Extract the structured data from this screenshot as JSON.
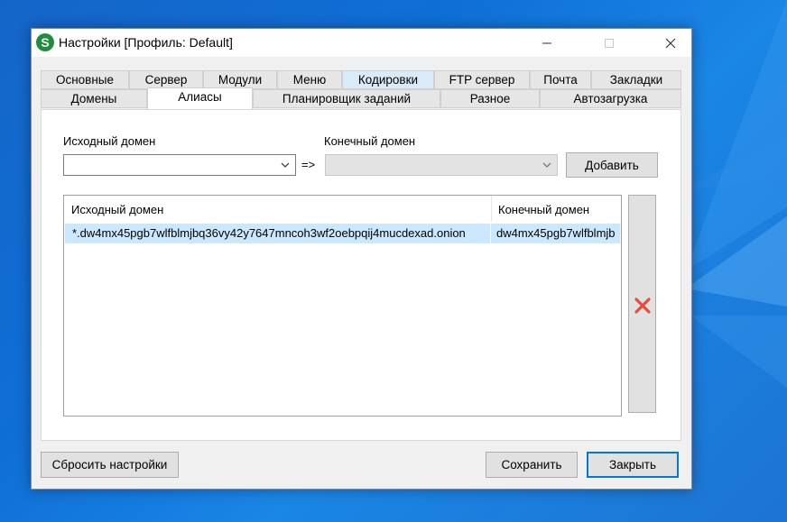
{
  "window": {
    "title": "Настройки [Профиль: Default]",
    "app_icon_letter": "S"
  },
  "tabs": {
    "row1": [
      "Основные",
      "Сервер",
      "Модули",
      "Меню",
      "Кодировки",
      "FTP сервер",
      "Почта",
      "Закладки"
    ],
    "row2": [
      "Домены",
      "Алиасы",
      "Планировщик заданий",
      "Разное",
      "Автозагрузка"
    ],
    "active": "Алиасы",
    "highlighted": "Кодировки"
  },
  "form": {
    "source_label": "Исходный домен",
    "target_label": "Конечный домен",
    "arrow_text": "=>",
    "source_value": "",
    "target_value": "",
    "add_label": "Добавить"
  },
  "list": {
    "columns": [
      "Исходный домен",
      "Конечный домен"
    ],
    "rows": [
      {
        "source": "*.dw4mx45pgb7wlfblmjbq36vy42y7647mncoh3wf2oebpqij4mucdexad.onion",
        "target": "dw4mx45pgb7wlfblmjb"
      }
    ]
  },
  "buttons": {
    "reset": "Сбросить настройки",
    "save": "Сохранить",
    "close": "Закрыть"
  },
  "colors": {
    "accent": "#0078d7",
    "selection": "#cce8ff",
    "delete_icon": "#e74c3c",
    "app_icon": "#1e8e3e"
  }
}
